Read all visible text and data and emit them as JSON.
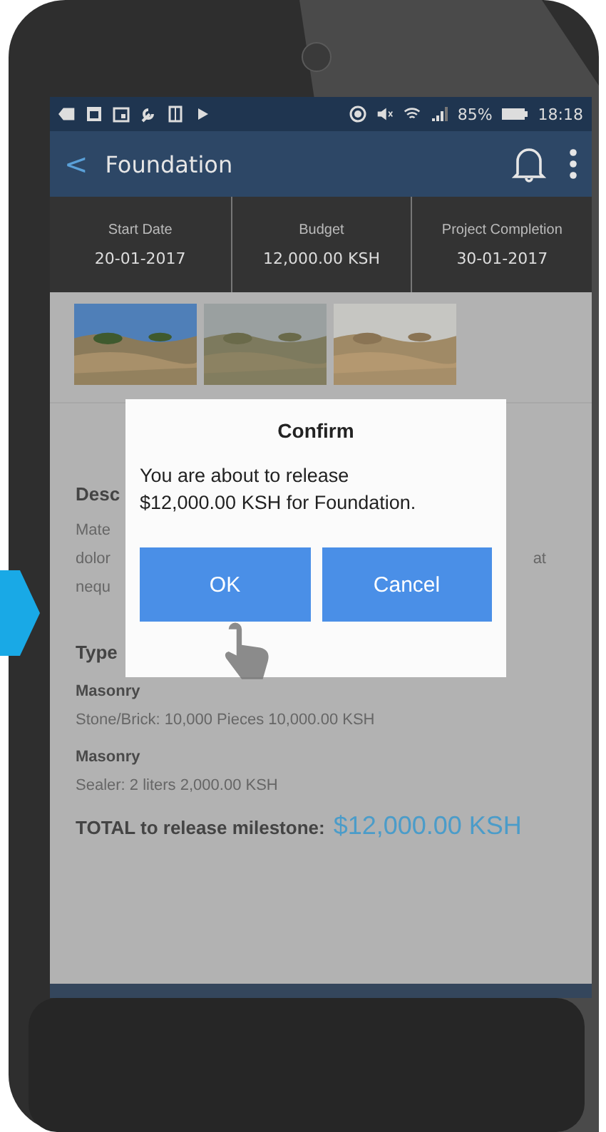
{
  "status_bar": {
    "battery": "85%",
    "time": "18:18"
  },
  "app_bar": {
    "back": "<",
    "title": "Foundation"
  },
  "stats": [
    {
      "label": "Start Date",
      "value": "20-01-2017"
    },
    {
      "label": "Budget",
      "value": "12,000.00 KSH"
    },
    {
      "label": "Project Completion",
      "value": "30-01-2017"
    }
  ],
  "description": {
    "heading": "Desc",
    "lines": [
      {
        "left": "Mate"
      },
      {
        "left": "dolor",
        "right": "at"
      },
      {
        "left": "nequ"
      }
    ]
  },
  "types_heading": "Type",
  "items": [
    {
      "category": "Masonry",
      "line": "Stone/Brick: 10,000 Pieces 10,000.00 KSH"
    },
    {
      "category": "Masonry",
      "line": "Sealer: 2 liters 2,000.00 KSH"
    }
  ],
  "total": {
    "label": "TOTAL to release milestone:",
    "amount": "$12,000.00 KSH"
  },
  "dialog": {
    "title": "Confirm",
    "message": "You are about to release $12,000.00 KSH for Foundation.",
    "buttons": [
      "OK",
      "Cancel"
    ]
  }
}
